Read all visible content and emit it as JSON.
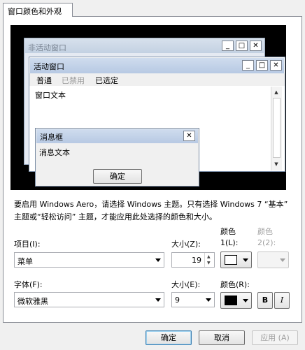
{
  "tab": {
    "label": "窗口颜色和外观"
  },
  "preview": {
    "inactive_title": "非活动窗口",
    "active_title": "活动窗口",
    "menu": [
      "普通",
      "已禁用",
      "已选定"
    ],
    "window_text": "窗口文本",
    "msgbox_title": "消息框",
    "msgbox_text": "消息文本",
    "msgbox_ok": "确定"
  },
  "description": "要启用 Windows Aero，请选择 Windows 主题。只有选择 Windows 7 “基本” 主题或“轻松访问” 主题，才能应用此处选择的颜色和大小。",
  "item": {
    "label": "项目(I):",
    "value": "菜单"
  },
  "item_size": {
    "label": "大小(Z):",
    "value": "19"
  },
  "color1": {
    "label_top": "颜色",
    "label_bottom": "1(L):",
    "value": "#ffffff"
  },
  "color2": {
    "label_top": "颜色",
    "label_bottom": "2(2):"
  },
  "font": {
    "label": "字体(F):",
    "value": "微软雅黑"
  },
  "font_size": {
    "label": "大小(E):",
    "value": "9"
  },
  "font_color": {
    "label": "颜色(R):",
    "value": "#000000"
  },
  "bold_label": "B",
  "italic_label": "I",
  "buttons": {
    "ok": "确定",
    "cancel": "取消",
    "apply": "应用 (A)"
  }
}
